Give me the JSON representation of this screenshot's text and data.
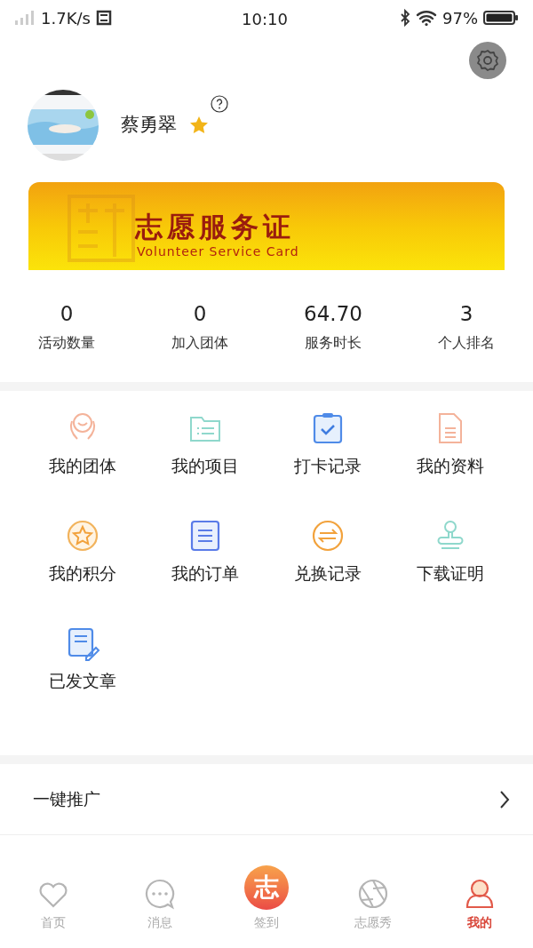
{
  "status_bar": {
    "speed": "1.7K/s",
    "time": "10:10",
    "battery": "97%"
  },
  "profile": {
    "name": "蔡勇翠"
  },
  "card": {
    "title": "志愿服务证",
    "subtitle": "Volunteer Service Card"
  },
  "stats": [
    {
      "value": "0",
      "label": "活动数量"
    },
    {
      "value": "0",
      "label": "加入团体"
    },
    {
      "value": "64.70",
      "label": "服务时长"
    },
    {
      "value": "3",
      "label": "个人排名"
    }
  ],
  "grid": [
    {
      "label": "我的团体",
      "kind": "hands"
    },
    {
      "label": "我的项目",
      "kind": "folder"
    },
    {
      "label": "打卡记录",
      "kind": "clipboard"
    },
    {
      "label": "我的资料",
      "kind": "document"
    },
    {
      "label": "我的积分",
      "kind": "star"
    },
    {
      "label": "我的订单",
      "kind": "list"
    },
    {
      "label": "兑换记录",
      "kind": "exchange"
    },
    {
      "label": "下载证明",
      "kind": "stamp"
    },
    {
      "label": "已发文章",
      "kind": "article"
    }
  ],
  "menu": [
    {
      "label": "一键推广"
    }
  ],
  "tabs": [
    {
      "label": "首页",
      "kind": "heart",
      "selected": false
    },
    {
      "label": "消息",
      "kind": "chat",
      "selected": false
    },
    {
      "label": "签到",
      "kind": "center",
      "glyph": "志",
      "selected": false
    },
    {
      "label": "志愿秀",
      "kind": "aperture",
      "selected": false
    },
    {
      "label": "我的",
      "kind": "person",
      "selected": true
    }
  ]
}
